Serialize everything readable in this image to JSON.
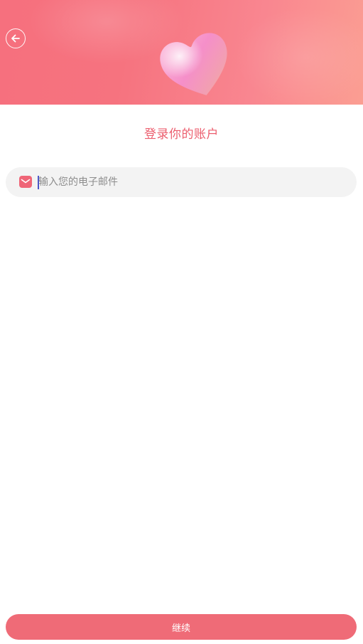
{
  "header": {
    "back_icon": "arrow-left-icon",
    "illustration_icon": "heart-icon",
    "gradient_start": "#f6707e",
    "gradient_end": "#fb9e92"
  },
  "title": "登录你的账户",
  "email_field": {
    "icon": "mail-icon",
    "placeholder": "输入您的电子邮件",
    "value": ""
  },
  "continue_button": {
    "label": "继续",
    "color": "#ef6b77"
  },
  "colors": {
    "accent": "#ec5d6d",
    "field_background": "#f3f3f3"
  }
}
